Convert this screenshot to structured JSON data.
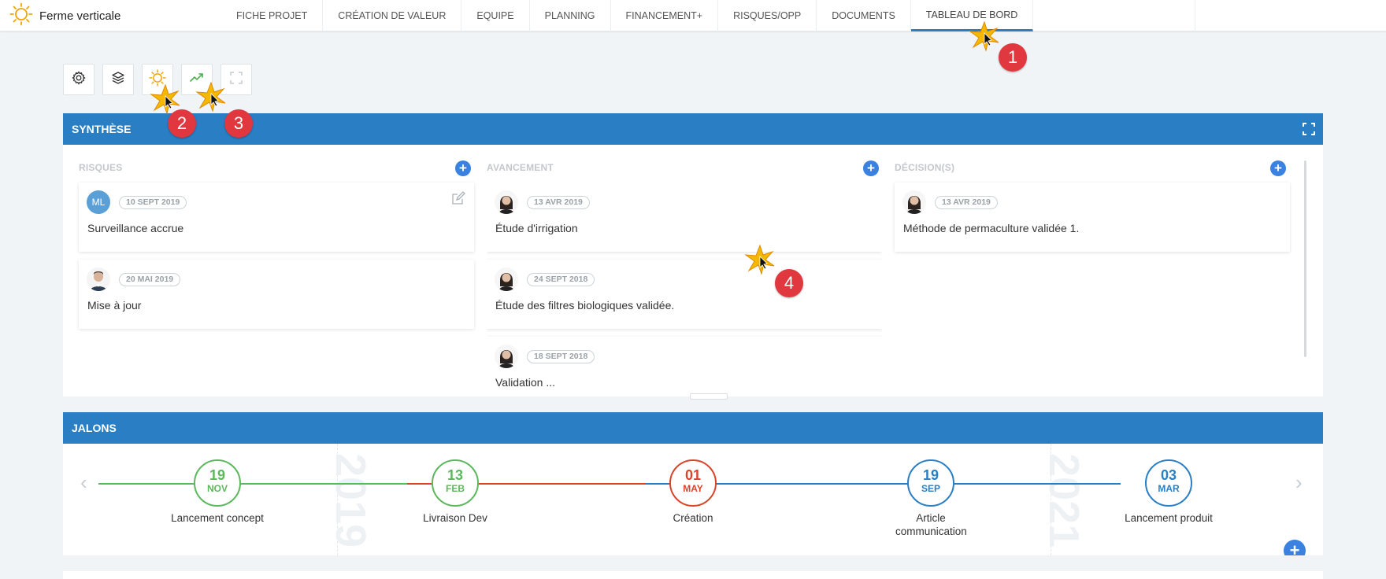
{
  "app": {
    "title": "Ferme verticale",
    "logo_icon": "sun-icon",
    "brand_color": "#f0a500"
  },
  "nav": {
    "tabs": [
      {
        "label": "FICHE PROJET"
      },
      {
        "label": "CRÉATION DE VALEUR"
      },
      {
        "label": "EQUIPE"
      },
      {
        "label": "PLANNING"
      },
      {
        "label": "FINANCEMENT+"
      },
      {
        "label": "RISQUES/OPP"
      },
      {
        "label": "DOCUMENTS"
      },
      {
        "label": "TABLEAU DE BORD",
        "active": true
      }
    ]
  },
  "toolbar": {
    "buttons": [
      {
        "icon": "gear-icon"
      },
      {
        "icon": "layers-icon"
      },
      {
        "icon": "sun-icon"
      },
      {
        "icon": "trend-up-icon"
      },
      {
        "icon": "fullscreen-icon"
      }
    ]
  },
  "synthese": {
    "title": "SYNTHÈSE",
    "columns": {
      "risques": {
        "title": "RISQUES",
        "cards": [
          {
            "initials": "ML",
            "date": "10 SEPT 2019",
            "text": "Surveillance accrue"
          },
          {
            "date": "20 MAI 2019",
            "text": "Mise à jour"
          }
        ]
      },
      "avancement": {
        "title": "AVANCEMENT",
        "cards": [
          {
            "date": "13 AVR 2019",
            "text": "Étude d'irrigation"
          },
          {
            "date": "24 SEPT 2018",
            "text": "Étude des filtres biologiques validée."
          },
          {
            "date": "18 SEPT 2018",
            "text": "Validation ..."
          }
        ]
      },
      "decisions": {
        "title": "DÉCISION(S)",
        "cards": [
          {
            "date": "13 AVR 2019",
            "text": "Méthode de permaculture validée 1."
          }
        ]
      }
    }
  },
  "jalons": {
    "title": "JALONS",
    "years": [
      "2019",
      "2021"
    ],
    "milestones": [
      {
        "day": "19",
        "month": "NOV",
        "label": "Lancement concept",
        "color": "#5cb85c"
      },
      {
        "day": "13",
        "month": "FEB",
        "label": "Livraison Dev",
        "color": "#5cb85c"
      },
      {
        "day": "01",
        "month": "MAY",
        "label": "Création",
        "color": "#d9452b"
      },
      {
        "day": "19",
        "month": "SEP",
        "label": "Article communication",
        "color": "#2a7fc4"
      },
      {
        "day": "03",
        "month": "MAR",
        "label": "Lancement produit",
        "color": "#2a7fc4"
      }
    ]
  },
  "annotations": [
    {
      "number": "1"
    },
    {
      "number": "2"
    },
    {
      "number": "3"
    },
    {
      "number": "4"
    }
  ]
}
